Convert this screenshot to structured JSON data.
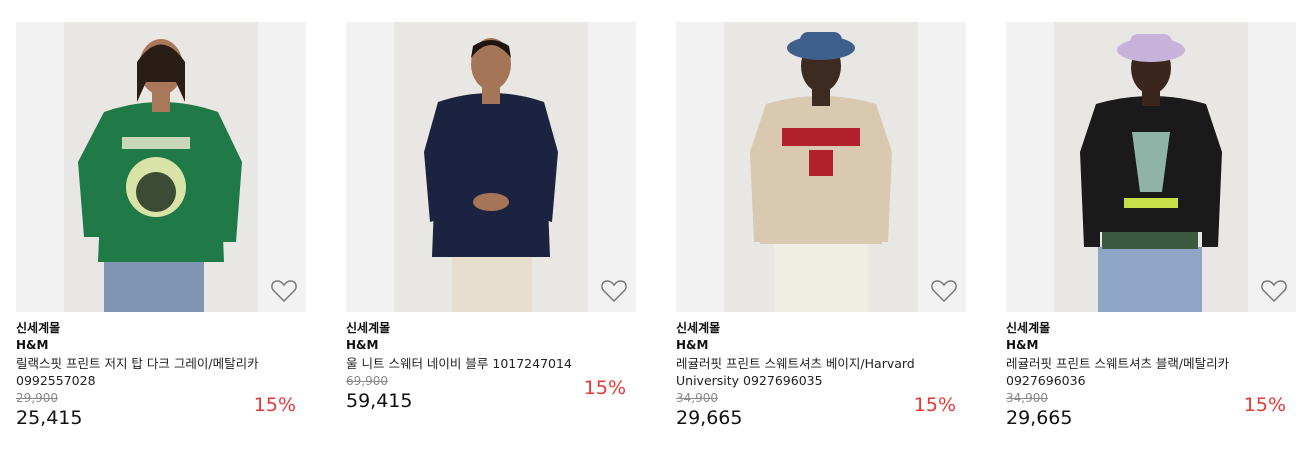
{
  "products": [
    {
      "shop": "신세계몰",
      "brand": "H&M",
      "name": "릴랙스핏 프린트 저지 탑 다크 그레이/메탈리카",
      "code": "0992557028",
      "original_price": "29,900",
      "price": "25,415",
      "discount": "15%",
      "image_icon": "green-metallica-longsleeve-photo"
    },
    {
      "shop": "신세계몰",
      "brand": "H&M",
      "name": "울 니트 스웨터 네이비 블루 1017247014",
      "code": "",
      "original_price": "69,900",
      "price": "59,415",
      "discount": "15%",
      "image_icon": "navy-knit-sweater-photo"
    },
    {
      "shop": "신세계몰",
      "brand": "H&M",
      "name": "레귤러핏 프린트 스웨트셔츠 베이지/Harvard",
      "code": "University 0927696035",
      "original_price": "34,900",
      "price": "29,665",
      "discount": "15%",
      "image_icon": "beige-harvard-sweatshirt-photo"
    },
    {
      "shop": "신세계몰",
      "brand": "H&M",
      "name": "레귤러핏 프린트 스웨트셔츠 블랙/메탈리카",
      "code": "0927696036",
      "original_price": "34,900",
      "price": "29,665",
      "discount": "15%",
      "image_icon": "black-metallica-sweatshirt-photo"
    }
  ],
  "colors": {
    "discount": "#e53935",
    "strike": "#8a8a8a",
    "image_bg": "#f2f2f2"
  }
}
